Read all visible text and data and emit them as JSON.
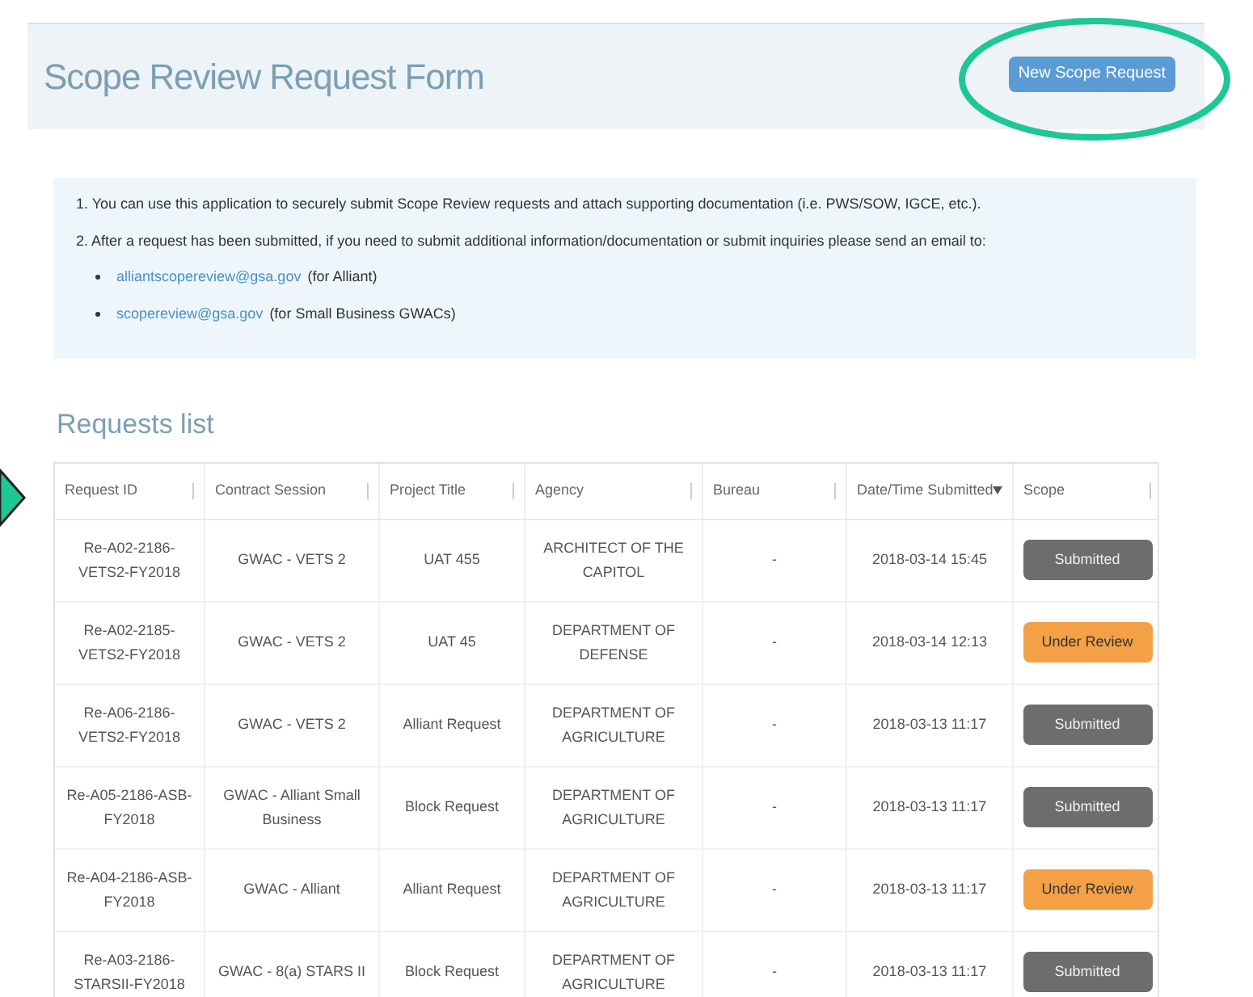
{
  "header": {
    "title": "Scope Review Request Form",
    "button": "New Scope Request"
  },
  "info": {
    "items": [
      "1. You can use this application to securely submit Scope Review requests and attach supporting documentation (i.e. PWS/SOW, IGCE, etc.).",
      "2. After a request has been submitted, if you need to submit additional information/documentation or submit inquiries please send an email to:"
    ],
    "emails": [
      {
        "link": "alliantscopereview@gsa.gov",
        "note": "(for Alliant)"
      },
      {
        "link": "scopereview@gsa.gov",
        "note": "(for Small Business GWACs)"
      }
    ]
  },
  "requests": {
    "heading": "Requests list",
    "columns": [
      {
        "label": "Request ID",
        "sorted": false
      },
      {
        "label": "Contract Session",
        "sorted": false
      },
      {
        "label": "Project Title",
        "sorted": false
      },
      {
        "label": "Agency",
        "sorted": false
      },
      {
        "label": "Bureau",
        "sorted": false
      },
      {
        "label": "Date/Time Submitted",
        "sorted": true
      },
      {
        "label": "Scope",
        "sorted": false
      }
    ],
    "rows": [
      {
        "id": "Re-A02-2186-VETS2-FY2018",
        "contract": "GWAC - VETS 2",
        "title": "UAT 455",
        "agency": "ARCHITECT OF THE CAPITOL",
        "bureau": "-",
        "submitted": "2018-03-14 15:45",
        "scope": {
          "label": "Submitted",
          "kind": "submitted"
        }
      },
      {
        "id": "Re-A02-2185-VETS2-FY2018",
        "contract": "GWAC - VETS 2",
        "title": "UAT 45",
        "agency": "DEPARTMENT OF DEFENSE",
        "bureau": "-",
        "submitted": "2018-03-14 12:13",
        "scope": {
          "label": "Under Review",
          "kind": "review"
        }
      },
      {
        "id": "Re-A06-2186-VETS2-FY2018",
        "contract": "GWAC - VETS 2",
        "title": "Alliant Request",
        "agency": "DEPARTMENT OF AGRICULTURE",
        "bureau": "-",
        "submitted": "2018-03-13 11:17",
        "scope": {
          "label": "Submitted",
          "kind": "submitted"
        }
      },
      {
        "id": "Re-A05-2186-ASB-FY2018",
        "contract": "GWAC - Alliant Small Business",
        "title": "Block Request",
        "agency": "DEPARTMENT OF AGRICULTURE",
        "bureau": "-",
        "submitted": "2018-03-13 11:17",
        "scope": {
          "label": "Submitted",
          "kind": "submitted"
        }
      },
      {
        "id": "Re-A04-2186-ASB-FY2018",
        "contract": "GWAC - Alliant",
        "title": "Alliant Request",
        "agency": "DEPARTMENT OF AGRICULTURE",
        "bureau": "-",
        "submitted": "2018-03-13 11:17",
        "scope": {
          "label": "Under Review",
          "kind": "review"
        }
      },
      {
        "id": "Re-A03-2186-STARSII-FY2018",
        "contract": "GWAC - 8(a) STARS II",
        "title": "Block Request",
        "agency": "DEPARTMENT OF AGRICULTURE",
        "bureau": "-",
        "submitted": "2018-03-13 11:17",
        "scope": {
          "label": "Submitted",
          "kind": "submitted"
        }
      }
    ]
  }
}
